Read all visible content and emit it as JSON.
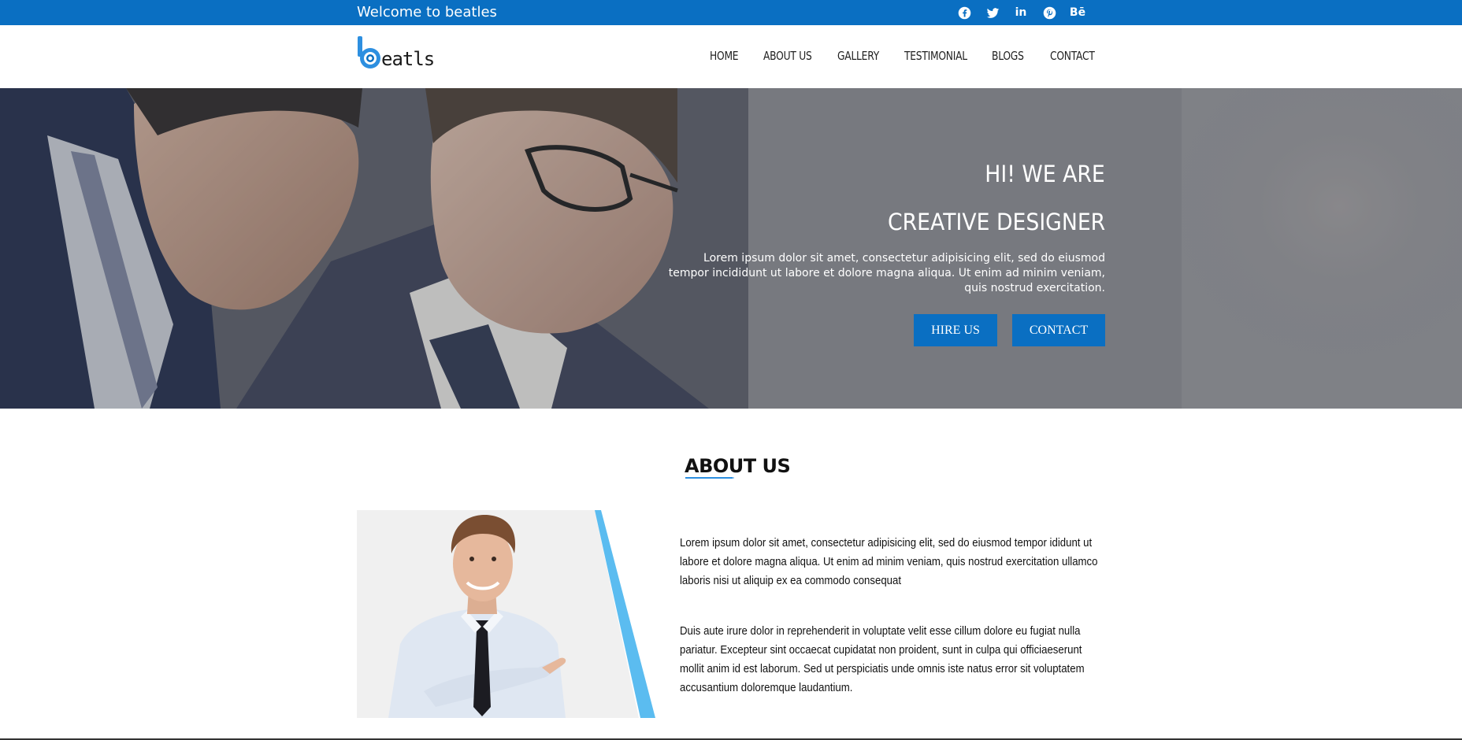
{
  "topbar": {
    "welcome": "Welcome to beatles",
    "socials": [
      {
        "name": "facebook-icon"
      },
      {
        "name": "twitter-icon"
      },
      {
        "name": "linkedin-icon",
        "text": "in"
      },
      {
        "name": "pinterest-icon"
      },
      {
        "name": "behance-icon",
        "text": "Bē"
      }
    ],
    "color": "#0a6fc2"
  },
  "header": {
    "logo_text": "eatls",
    "nav": [
      "HOME",
      "ABOUT US",
      "GALLERY",
      "TESTIMONIAL",
      "BLOGS",
      "CONTACT"
    ]
  },
  "hero": {
    "line1": "HI! WE ARE",
    "line2": "CREATIVE DESIGNER",
    "description": "Lorem ipsum dolor sit amet, consectetur adipisicing elit, sed do eiusmod tempor incididunt ut labore et dolore magna aliqua. Ut enim ad minim veniam, quis nostrud exercitation.",
    "hire_label": "HIRE US",
    "contact_label": "CONTACT"
  },
  "about": {
    "title": "ABOUT US",
    "p1": "Lorem ipsum dolor sit amet, consectetur adipisicing elit, sed do eiusmod tempor ididunt ut labore et dolore magna aliqua. Ut enim ad minim veniam, quis nostrud exercitation ullamco laboris nisi ut aliquip ex ea commodo consequat",
    "p2": "Duis aute irure dolor in reprehenderit in voluptate velit esse cillum dolore eu fugiat nulla pariatur. Excepteur sint occaecat cupidatat non proident, sunt in culpa qui officiaeserunt mollit anim id est laborum. Sed ut perspiciatis unde omnis iste natus error sit voluptatem accusantium doloremque laudantium."
  }
}
